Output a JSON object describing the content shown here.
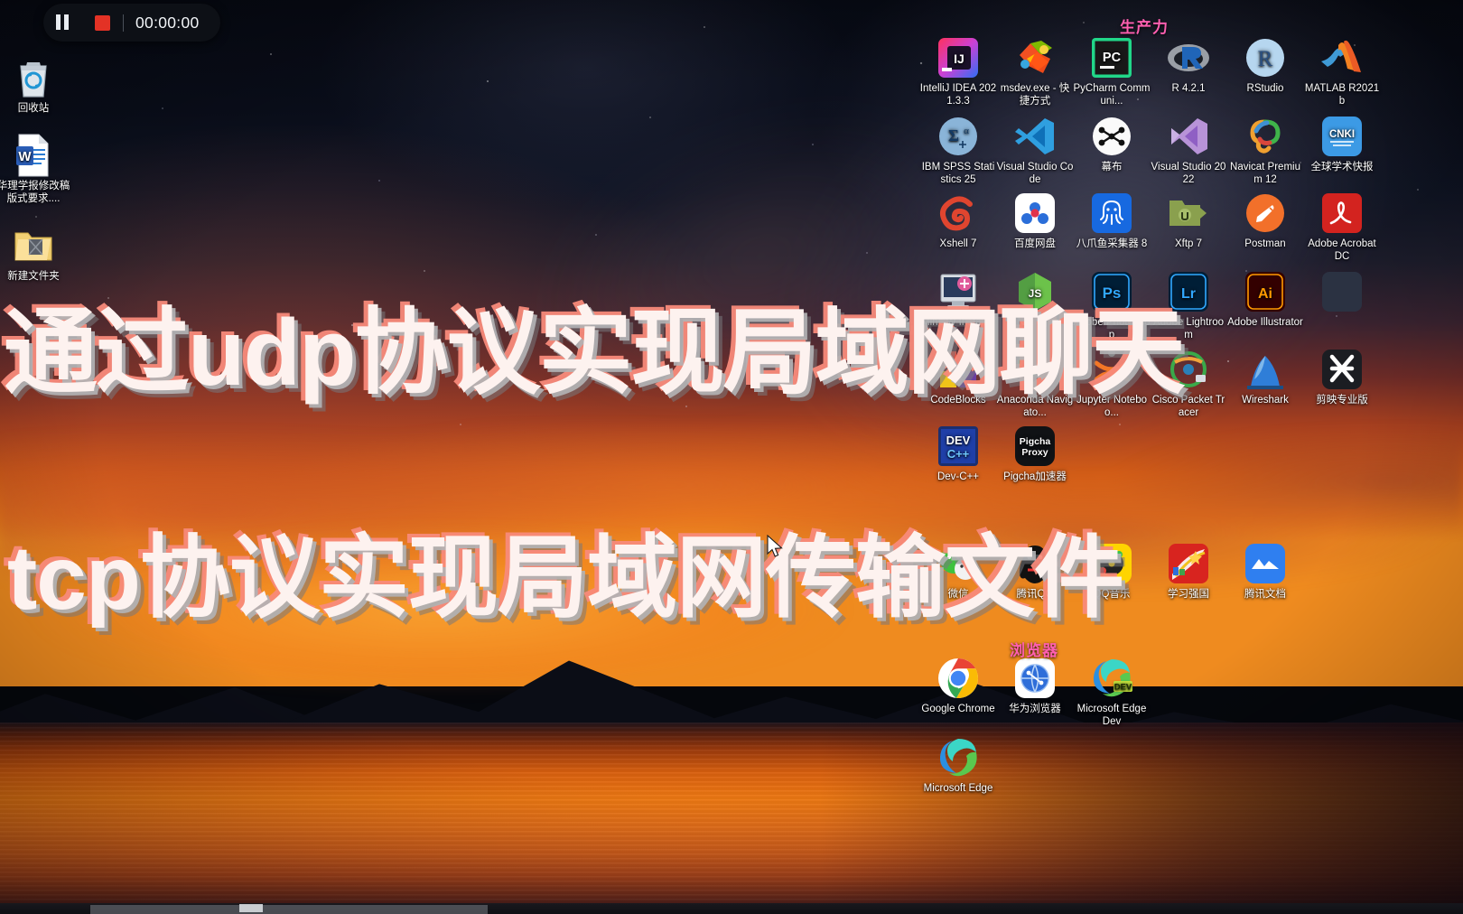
{
  "recorder": {
    "pause_label": "Pause",
    "stop_label": "Stop",
    "time": "00:00:00"
  },
  "overlay": {
    "line1": "通过udp协议实现局域网聊天",
    "line2": "tcp协议实现局域网传输文件",
    "text_color": "#fdf2ef",
    "shadow_pink": "#f88a7a",
    "shadow_gray": "#b2b2b4"
  },
  "groups": [
    {
      "title": "生产力",
      "color": "#ff5fb0"
    },
    {
      "title": "浏览器",
      "color": "#ff5fb0"
    }
  ],
  "left_icons": [
    {
      "name": "recycle-bin",
      "label": "回收站"
    },
    {
      "name": "word-doc",
      "label": "华理学报修改稿版式要求...."
    },
    {
      "name": "new-folder",
      "label": "新建文件夹"
    }
  ],
  "productivity_icons": [
    {
      "name": "intellij-idea",
      "label": "IntelliJ IDEA 2021.3.3"
    },
    {
      "name": "msdev-exe",
      "label": "msdev.exe - 快捷方式"
    },
    {
      "name": "pycharm",
      "label": "PyCharm Communi..."
    },
    {
      "name": "r-421",
      "label": "R 4.2.1"
    },
    {
      "name": "rstudio",
      "label": "RStudio"
    },
    {
      "name": "matlab",
      "label": "MATLAB R2021b"
    },
    {
      "name": "ibm-spss",
      "label": "IBM SPSS Statistics 25"
    },
    {
      "name": "vscode",
      "label": "Visual Studio Code"
    },
    {
      "name": "mubu",
      "label": "幕布"
    },
    {
      "name": "visual-studio",
      "label": "Visual Studio 2022"
    },
    {
      "name": "navicat",
      "label": "Navicat Premium 12"
    },
    {
      "name": "cnki",
      "label": "全球学术快报"
    },
    {
      "name": "xshell",
      "label": "Xshell 7"
    },
    {
      "name": "baidu-netdisk",
      "label": "百度网盘"
    },
    {
      "name": "bazhuayu",
      "label": "八爪鱼采集器 8"
    },
    {
      "name": "xftp",
      "label": "Xftp 7"
    },
    {
      "name": "postman",
      "label": "Postman"
    },
    {
      "name": "adobe-acrobat",
      "label": "Adobe Acrobat DC"
    },
    {
      "name": "mingw-installer",
      "label": "MinGW Installer"
    },
    {
      "name": "nodejs",
      "label": "Node.js"
    },
    {
      "name": "photoshop",
      "label": "Adobe Photoshop"
    },
    {
      "name": "lightroom",
      "label": "Adobe Lightroom"
    },
    {
      "name": "illustrator",
      "label": "Adobe Illustrator"
    },
    {
      "name": "unknown-app",
      "label": ""
    },
    {
      "name": "codeblocks",
      "label": "CodeBlocks"
    },
    {
      "name": "anaconda",
      "label": "Anaconda Navigato..."
    },
    {
      "name": "jupyter",
      "label": "Jupyter Noteboo..."
    },
    {
      "name": "cisco-packet-tracer",
      "label": "Cisco Packet Tracer"
    },
    {
      "name": "wireshark",
      "label": "Wireshark"
    },
    {
      "name": "jianying",
      "label": "剪映专业版"
    },
    {
      "name": "dev-cpp",
      "label": "Dev-C++"
    },
    {
      "name": "pigcha-proxy",
      "label": "Pigcha加速器"
    }
  ],
  "social_icons": [
    {
      "name": "wechat",
      "label": "微信"
    },
    {
      "name": "tencent-qq",
      "label": "腾讯QQ"
    },
    {
      "name": "qq-music",
      "label": "QQ音乐"
    },
    {
      "name": "xuexi-qiangguo",
      "label": "学习强国"
    },
    {
      "name": "tencent-docs",
      "label": "腾讯文档"
    }
  ],
  "browser_icons": [
    {
      "name": "google-chrome",
      "label": "Google Chrome"
    },
    {
      "name": "huawei-browser",
      "label": "华为浏览器"
    },
    {
      "name": "microsoft-edge-dev",
      "label": "Microsoft Edge Dev"
    },
    {
      "name": "microsoft-edge",
      "label": "Microsoft Edge"
    }
  ],
  "badges": {
    "pycharm": "PC",
    "intellij": "IJ",
    "r": "R",
    "cnki": "CNKI",
    "dev": "DEV",
    "devcpp_top": "DEV",
    "devcpp_bottom": "C++",
    "pigcha_l1": "Pigcha",
    "pigcha_l2": "Proxy",
    "word": "W",
    "edge_dev": "DEV"
  }
}
